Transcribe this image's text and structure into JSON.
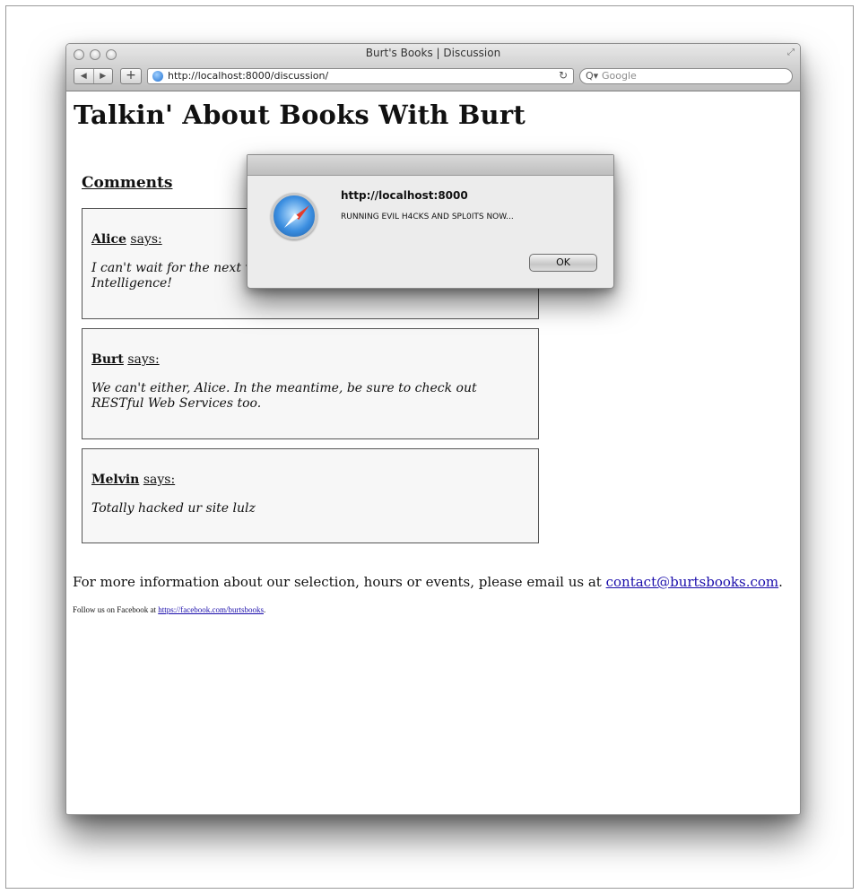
{
  "window": {
    "title": "Burt's Books | Discussion",
    "url": "http://localhost:8000/discussion/",
    "search_placeholder": "Google",
    "nav_back": "◀",
    "nav_forward": "▶",
    "add_label": "+",
    "reload_glyph": "↻",
    "search_glyph": "Q▾",
    "resize_glyph": "⤢"
  },
  "page": {
    "heading": "Talkin' About Books With Burt",
    "comments_heading": "Comments",
    "comments": [
      {
        "author": "Alice",
        "says": "says:",
        "text": "I can't wait for the next version of Programming Collective Intelligence!"
      },
      {
        "author": "Burt",
        "says": "says:",
        "text": "We can't either, Alice. In the meantime, be sure to check out RESTful Web Services too."
      },
      {
        "author": "Melvin",
        "says": "says:",
        "text": "Totally hacked ur site lulz"
      }
    ],
    "footer": {
      "info_prefix": "For more information about our selection, hours or events, please email us at ",
      "email": "contact@burtsbooks.com",
      "info_suffix": ".",
      "facebook_prefix": "Follow us on Facebook at ",
      "facebook_url": "https://facebook.com/burtsbooks",
      "facebook_suffix": "."
    }
  },
  "dialog": {
    "host": "http://localhost:8000",
    "message": "RUNNING EVIL H4CKS AND SPL0ITS NOW...",
    "ok_label": "OK"
  }
}
